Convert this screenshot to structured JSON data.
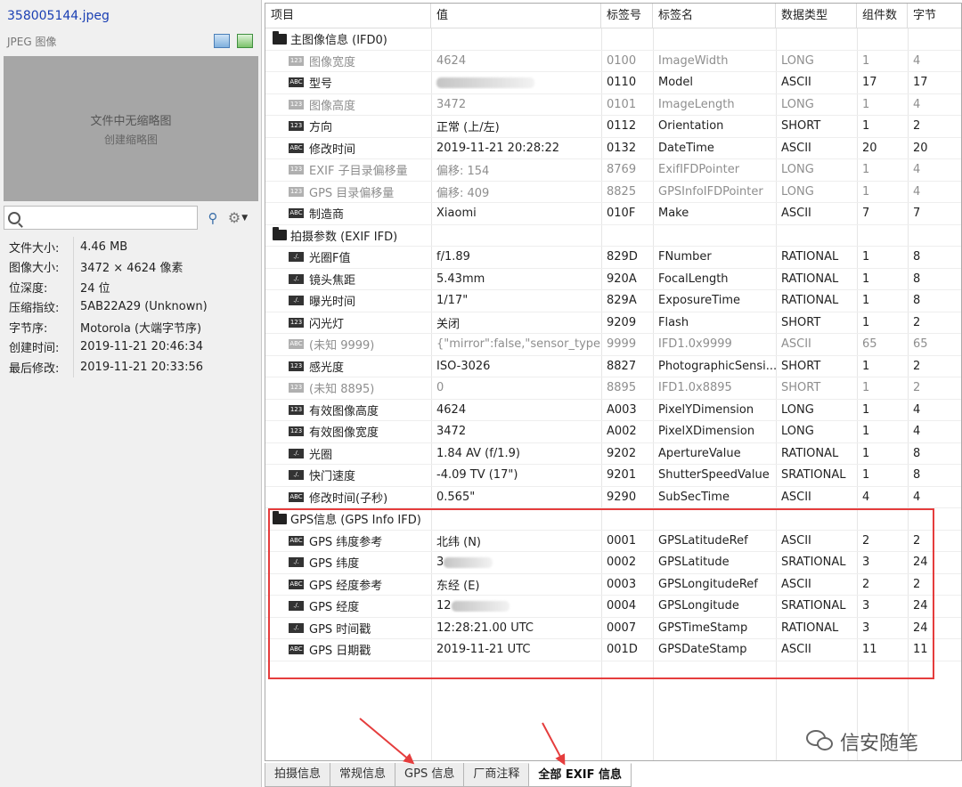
{
  "left": {
    "file_name": "358005144.jpeg",
    "file_type": "JPEG 图像",
    "thumb_line1": "文件中无缩略图",
    "thumb_line2": "创建缩略图",
    "search_placeholder": "",
    "props": [
      {
        "k": "文件大小:",
        "v": "4.46 MB"
      },
      {
        "k": "图像大小:",
        "v": "3472 × 4624 像素"
      },
      {
        "k": "位深度:",
        "v": "24 位"
      },
      {
        "k": "压缩指纹:",
        "v": "5AB22A29 (Unknown)"
      },
      {
        "k": "字节序:",
        "v": "Motorola (大端字节序)"
      },
      {
        "k": "创建时间:",
        "v": "2019-11-21 20:46:34"
      },
      {
        "k": "最后修改:",
        "v": "2019-11-21 20:33:56"
      }
    ]
  },
  "table": {
    "headers": [
      "项目",
      "值",
      "标签号",
      "标签名",
      "数据类型",
      "组件数",
      "字节"
    ],
    "rows": [
      {
        "group": true,
        "name": "主图像信息 (IFD0)"
      },
      {
        "icon": "123",
        "dim": true,
        "name": "图像宽度",
        "value": "4624",
        "tag": "0100",
        "tagname": "ImageWidth",
        "type": "LONG",
        "count": "1",
        "bytes": "4"
      },
      {
        "icon": "ABC",
        "dim": false,
        "name": "型号",
        "value": "",
        "blur": 110,
        "tag": "0110",
        "tagname": "Model",
        "type": "ASCII",
        "count": "17",
        "bytes": "17"
      },
      {
        "icon": "123",
        "dim": true,
        "name": "图像高度",
        "value": "3472",
        "tag": "0101",
        "tagname": "ImageLength",
        "type": "LONG",
        "count": "1",
        "bytes": "4"
      },
      {
        "icon": "123",
        "dim": false,
        "name": "方向",
        "value": "正常 (上/左)",
        "tag": "0112",
        "tagname": "Orientation",
        "type": "SHORT",
        "count": "1",
        "bytes": "2"
      },
      {
        "icon": "ABC",
        "dim": false,
        "name": "修改时间",
        "value": "2019-11-21 20:28:22",
        "tag": "0132",
        "tagname": "DateTime",
        "type": "ASCII",
        "count": "20",
        "bytes": "20"
      },
      {
        "icon": "123",
        "dim": true,
        "name": "EXIF 子目录偏移量",
        "value": "偏移: 154",
        "tag": "8769",
        "tagname": "ExifIFDPointer",
        "type": "LONG",
        "count": "1",
        "bytes": "4"
      },
      {
        "icon": "123",
        "dim": true,
        "name": "GPS 目录偏移量",
        "value": "偏移: 409",
        "tag": "8825",
        "tagname": "GPSInfoIFDPointer",
        "type": "LONG",
        "count": "1",
        "bytes": "4"
      },
      {
        "icon": "ABC",
        "dim": false,
        "name": "制造商",
        "value": "Xiaomi",
        "tag": "010F",
        "tagname": "Make",
        "type": "ASCII",
        "count": "7",
        "bytes": "7"
      },
      {
        "group": true,
        "name": "拍摄参数 (EXIF IFD)"
      },
      {
        "icon": "./.",
        "dim": false,
        "name": "光圈F值",
        "value": "f/1.89",
        "tag": "829D",
        "tagname": "FNumber",
        "type": "RATIONAL",
        "count": "1",
        "bytes": "8"
      },
      {
        "icon": "./.",
        "dim": false,
        "name": "镜头焦距",
        "value": "5.43mm",
        "tag": "920A",
        "tagname": "FocalLength",
        "type": "RATIONAL",
        "count": "1",
        "bytes": "8"
      },
      {
        "icon": "./.",
        "dim": false,
        "name": "曝光时间",
        "value": "1/17\"",
        "tag": "829A",
        "tagname": "ExposureTime",
        "type": "RATIONAL",
        "count": "1",
        "bytes": "8"
      },
      {
        "icon": "123",
        "dim": false,
        "name": "闪光灯",
        "value": "关闭",
        "tag": "9209",
        "tagname": "Flash",
        "type": "SHORT",
        "count": "1",
        "bytes": "2"
      },
      {
        "icon": "ABC",
        "dim": true,
        "name": "(未知 9999)",
        "value": "{\"mirror\":false,\"sensor_type...",
        "tag": "9999",
        "tagname": "IFD1.0x9999",
        "type": "ASCII",
        "count": "65",
        "bytes": "65"
      },
      {
        "icon": "123",
        "dim": false,
        "name": "感光度",
        "value": "ISO-3026",
        "tag": "8827",
        "tagname": "PhotographicSensi...",
        "type": "SHORT",
        "count": "1",
        "bytes": "2"
      },
      {
        "icon": "123",
        "dim": true,
        "name": "(未知 8895)",
        "value": "0",
        "tag": "8895",
        "tagname": "IFD1.0x8895",
        "type": "SHORT",
        "count": "1",
        "bytes": "2"
      },
      {
        "icon": "123",
        "dim": false,
        "name": "有效图像高度",
        "value": "4624",
        "tag": "A003",
        "tagname": "PixelYDimension",
        "type": "LONG",
        "count": "1",
        "bytes": "4"
      },
      {
        "icon": "123",
        "dim": false,
        "name": "有效图像宽度",
        "value": "3472",
        "tag": "A002",
        "tagname": "PixelXDimension",
        "type": "LONG",
        "count": "1",
        "bytes": "4"
      },
      {
        "icon": "./.",
        "dim": false,
        "name": "光圈",
        "value": "1.84 AV (f/1.9)",
        "tag": "9202",
        "tagname": "ApertureValue",
        "type": "RATIONAL",
        "count": "1",
        "bytes": "8"
      },
      {
        "icon": "./.",
        "dim": false,
        "name": "快门速度",
        "value": "-4.09 TV (17\")",
        "tag": "9201",
        "tagname": "ShutterSpeedValue",
        "type": "SRATIONAL",
        "count": "1",
        "bytes": "8"
      },
      {
        "icon": "ABC",
        "dim": false,
        "name": "修改时间(子秒)",
        "value": "0.565\"",
        "tag": "9290",
        "tagname": "SubSecTime",
        "type": "ASCII",
        "count": "4",
        "bytes": "4"
      },
      {
        "group": true,
        "name": "GPS信息 (GPS Info IFD)"
      },
      {
        "icon": "ABC",
        "dim": false,
        "name": "GPS 纬度参考",
        "value": "北纬 (N)",
        "tag": "0001",
        "tagname": "GPSLatitudeRef",
        "type": "ASCII",
        "count": "2",
        "bytes": "2"
      },
      {
        "icon": "./.",
        "dim": false,
        "name": "GPS 纬度",
        "value": "3",
        "blur": 55,
        "tag": "0002",
        "tagname": "GPSLatitude",
        "type": "SRATIONAL",
        "count": "3",
        "bytes": "24"
      },
      {
        "icon": "ABC",
        "dim": false,
        "name": "GPS 经度参考",
        "value": "东经 (E)",
        "tag": "0003",
        "tagname": "GPSLongitudeRef",
        "type": "ASCII",
        "count": "2",
        "bytes": "2"
      },
      {
        "icon": "./.",
        "dim": false,
        "name": "GPS 经度",
        "value": "12",
        "blur": 65,
        "tag": "0004",
        "tagname": "GPSLongitude",
        "type": "SRATIONAL",
        "count": "3",
        "bytes": "24"
      },
      {
        "icon": "./.",
        "dim": false,
        "name": "GPS 时间戳",
        "value": "12:28:21.00 UTC",
        "tag": "0007",
        "tagname": "GPSTimeStamp",
        "type": "RATIONAL",
        "count": "3",
        "bytes": "24"
      },
      {
        "icon": "ABC",
        "dim": false,
        "name": "GPS 日期戳",
        "value": "2019-11-21 UTC",
        "tag": "001D",
        "tagname": "GPSDateStamp",
        "type": "ASCII",
        "count": "11",
        "bytes": "11"
      }
    ]
  },
  "tabs": [
    {
      "label": "拍摄信息",
      "active": false
    },
    {
      "label": "常规信息",
      "active": false
    },
    {
      "label": "GPS 信息",
      "active": false
    },
    {
      "label": "厂商注释",
      "active": false
    },
    {
      "label": "全部 EXIF 信息",
      "active": true
    }
  ],
  "watermark": "信安随笔",
  "colors": {
    "highlight": "#e53d3d",
    "filename": "#1a3fb3"
  }
}
